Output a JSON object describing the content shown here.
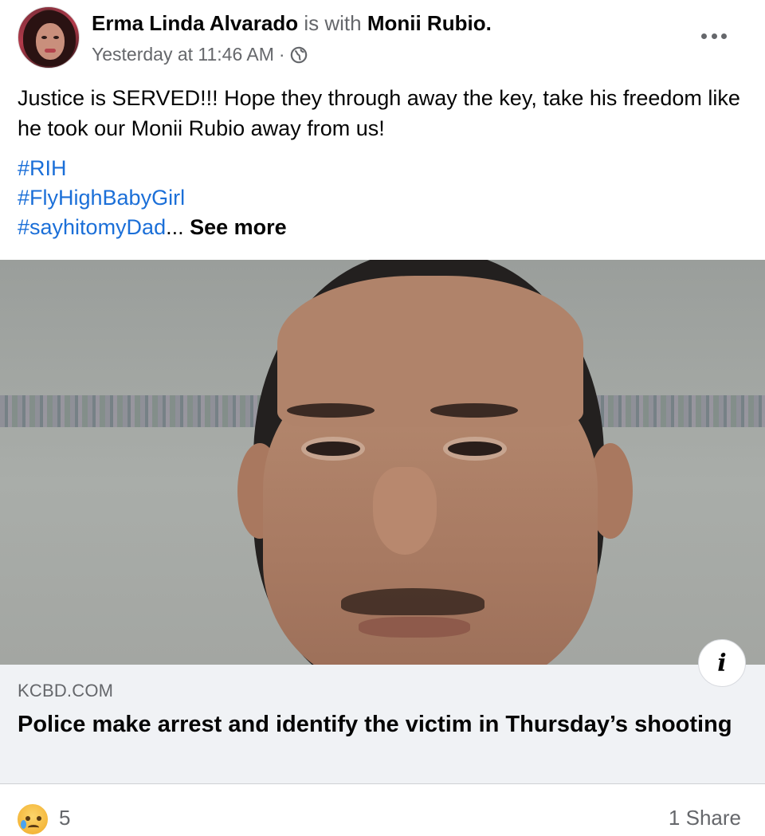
{
  "post": {
    "author": "Erma Linda Alvarado",
    "with_text": "is with",
    "tagged": "Monii Rubio",
    "period": ".",
    "timestamp": "Yesterday at 11:46 AM",
    "separator": "·",
    "privacy_icon": "globe-icon",
    "more_icon": "more-horizontal-icon",
    "text": "Justice is SERVED!!! Hope they through away the key, take his freedom like he took our Monii Rubio  away from us!",
    "hashtags": [
      "#RIH",
      "#FlyHighBabyGirl",
      "#sayhitomyDad"
    ],
    "ellipsis": "...",
    "see_more": "See more"
  },
  "link_preview": {
    "domain": "KCBD.COM",
    "title": "Police make arrest and identify the victim in Thursday’s shooting",
    "info_icon_glyph": "i"
  },
  "footer": {
    "reaction_icon": "sad-reaction-icon",
    "reaction_count": "5",
    "share_count": "1 Share"
  },
  "colors": {
    "link": "#1b6fd8",
    "muted": "#65676b",
    "preview_bg": "#f0f2f5"
  }
}
